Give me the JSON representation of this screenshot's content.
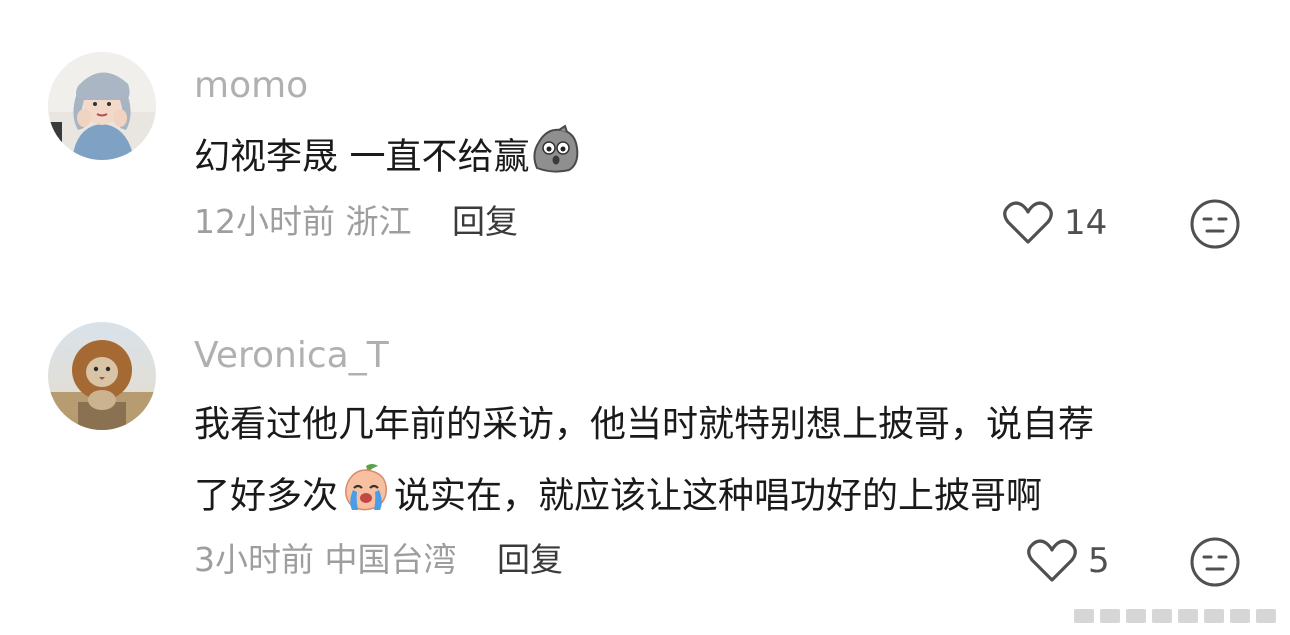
{
  "comments": [
    {
      "username": "momo",
      "text": "幻视李晟 一直不给赢",
      "emoji_icon": "shocked-rock-emoji",
      "time": "12小时前",
      "location": "浙江",
      "reply_label": "回复",
      "likes": "14"
    },
    {
      "username": "Veronica_T",
      "text_line1": "我看过他几年前的采访，他当时就特别想上披哥，说自荐",
      "text_line2_before": "了好多次",
      "emoji_icon": "crying-peach-emoji",
      "text_line2_after": "说实在，就应该让这种唱功好的上披哥啊",
      "time": "3小时前",
      "location": "中国台湾",
      "reply_label": "回复",
      "likes": "5"
    }
  ],
  "icons": {
    "like": "heart-icon",
    "dislike": "neutral-face-icon"
  },
  "colors": {
    "username": "#b0b0b0",
    "text": "#1a1a1a",
    "meta": "#9e9e9e",
    "reply": "#3a3a3a",
    "icon": "#505050"
  }
}
